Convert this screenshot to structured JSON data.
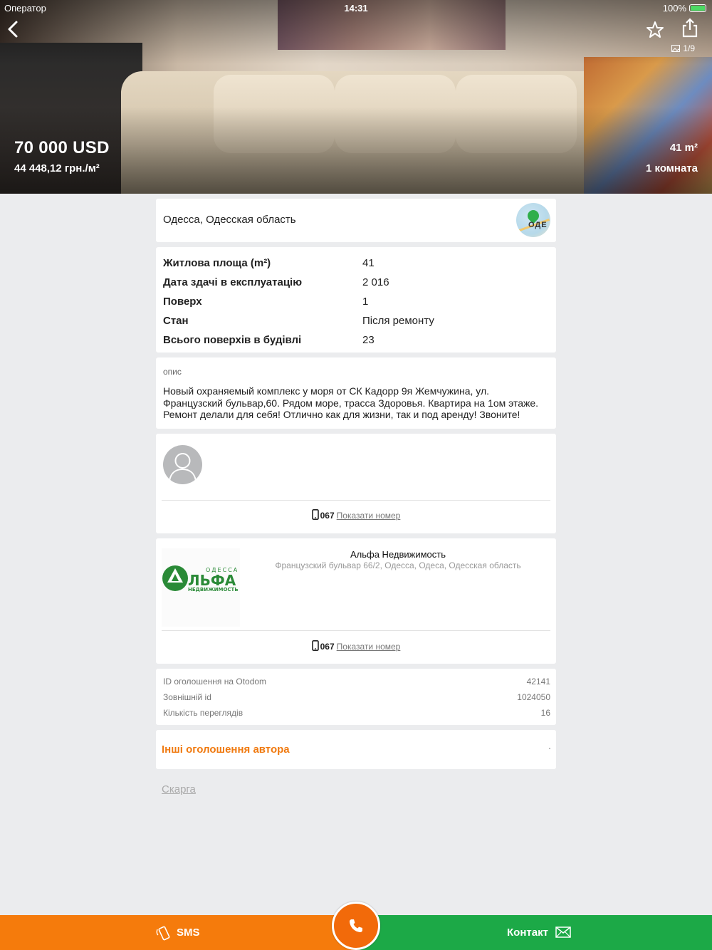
{
  "status_bar": {
    "carrier": "Оператор",
    "time": "14:31",
    "battery": "100%"
  },
  "hero": {
    "price": "70 000 USD",
    "price_per_m2": "44 448,12 грн./м²",
    "area": "41 m²",
    "rooms": "1 комната",
    "photo_counter": "1/9"
  },
  "location": {
    "text": "Одесса, Одесская область",
    "map_label": "ОДЕ"
  },
  "params": [
    {
      "label": "Житлова площа (m²)",
      "value": "41"
    },
    {
      "label": "Дата здачі в експлуатацію",
      "value": "2 016"
    },
    {
      "label": "Поверх",
      "value": "1"
    },
    {
      "label": "Стан",
      "value": "Після ремонту"
    },
    {
      "label": "Всього поверхів в будівлі",
      "value": "23"
    }
  ],
  "description": {
    "heading": "опис",
    "text": "Новый охраняемый комплекс у моря от СК Кадорр  9я Жемчужина, ул. Французский бульвар,60. Рядом море, трасса Здоровья. Квартира на 1ом этаже. Ремонт делали для себя! Отлично как для жизни, так и под аренду! Звоните!"
  },
  "author": {
    "phone_prefix": "067",
    "show_number": "Показати номер"
  },
  "agency": {
    "name": "Альфа Недвижимость",
    "address": "Французский бульвар 66/2, Одесса, Одеса, Одесская область",
    "logo_top": "ОДЕССА",
    "logo_main": "ЛЬФА",
    "logo_sub": "НЕДВИЖИМОСТЬ",
    "phone_prefix": "067",
    "show_number": "Показати номер"
  },
  "meta": [
    {
      "label": "ID оголошення на Otodom",
      "value": "42141"
    },
    {
      "label": "Зовнішній id",
      "value": "1024050"
    },
    {
      "label": "Кількість переглядів",
      "value": "16"
    }
  ],
  "other_listings": "Інші оголошення автора",
  "complaint": "Скарга",
  "bottom_bar": {
    "sms": "SMS",
    "contact": "Контакт"
  },
  "colors": {
    "orange": "#f57b0c",
    "green": "#1ca947",
    "link_orange": "#f07a10"
  }
}
